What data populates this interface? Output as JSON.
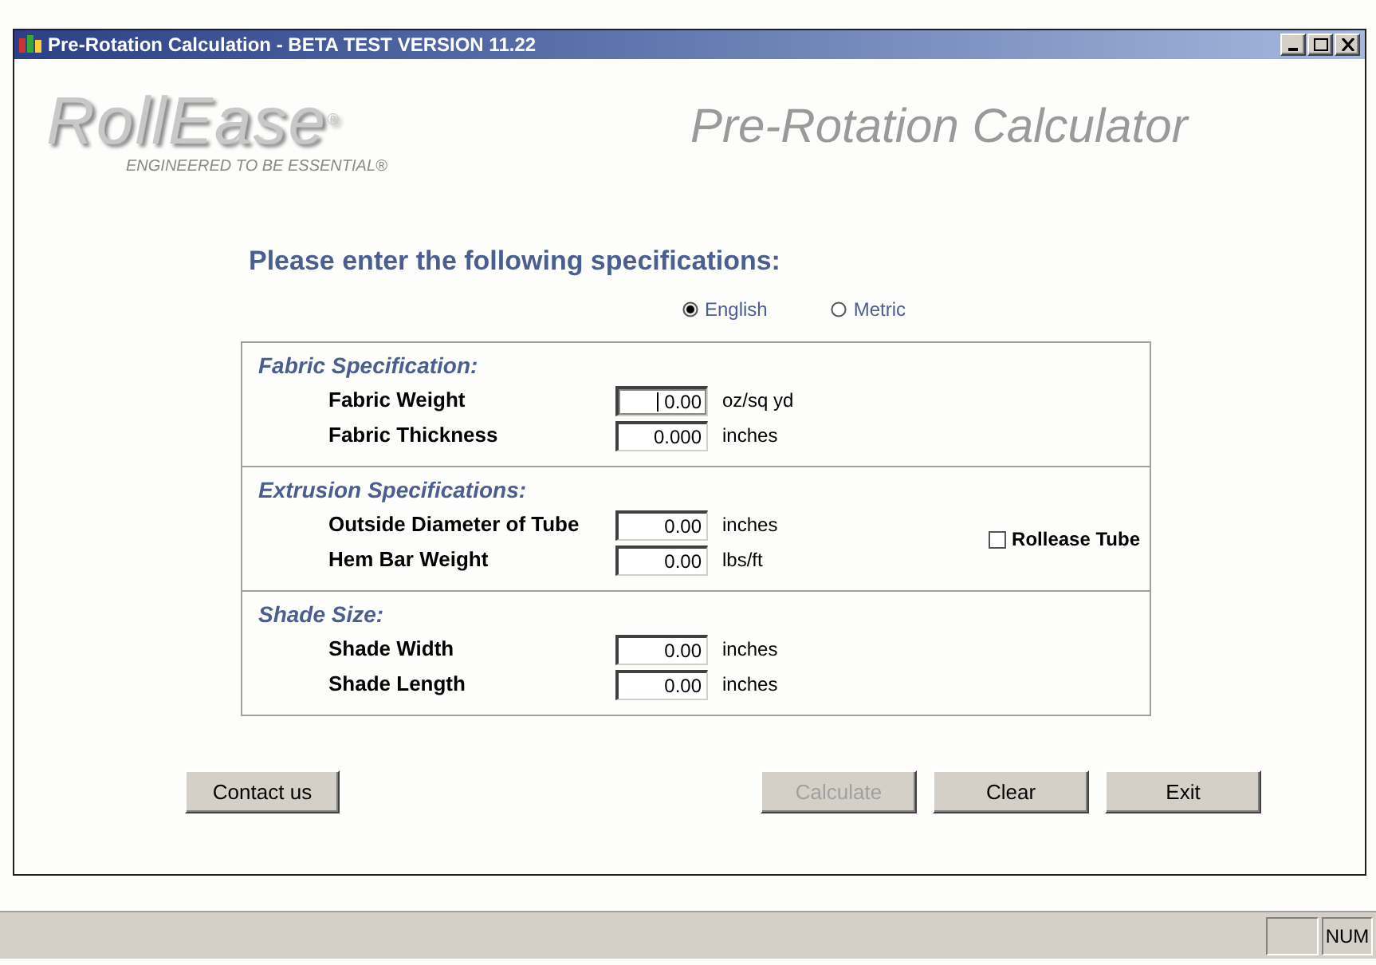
{
  "window": {
    "title": "Pre-Rotation Calculation - BETA TEST VERSION 11.22"
  },
  "logo": {
    "brand": "RollEase",
    "registered": "®",
    "tagline": "ENGINEERED TO BE ESSENTIAL®"
  },
  "app_title": "Pre-Rotation Calculator",
  "heading": "Please enter the following specifications:",
  "units": [
    {
      "label": "English",
      "selected": true
    },
    {
      "label": "Metric",
      "selected": false
    }
  ],
  "sections": [
    {
      "title": "Fabric Specification:",
      "rows": [
        {
          "label": "Fabric Weight",
          "value": "0.00",
          "unit": "oz/sq yd",
          "focused": true
        },
        {
          "label": "Fabric Thickness",
          "value": "0.000",
          "unit": "inches",
          "focused": false
        }
      ]
    },
    {
      "title": "Extrusion Specifications:",
      "checkbox": {
        "label": "Rollease Tube",
        "checked": false
      },
      "rows": [
        {
          "label": "Outside Diameter of Tube",
          "value": "0.00",
          "unit": "inches",
          "focused": false
        },
        {
          "label": "Hem Bar Weight",
          "value": "0.00",
          "unit": "lbs/ft",
          "focused": false
        }
      ]
    },
    {
      "title": "Shade Size:",
      "rows": [
        {
          "label": "Shade Width",
          "value": "0.00",
          "unit": "inches",
          "focused": false
        },
        {
          "label": "Shade Length",
          "value": "0.00",
          "unit": "inches",
          "focused": false
        }
      ]
    }
  ],
  "buttons": [
    {
      "label": "Contact us",
      "disabled": false
    },
    {
      "label": "Calculate",
      "disabled": true
    },
    {
      "label": "Clear",
      "disabled": false
    },
    {
      "label": "Exit",
      "disabled": false
    }
  ],
  "status_bar": {
    "indicator": "NUM"
  }
}
